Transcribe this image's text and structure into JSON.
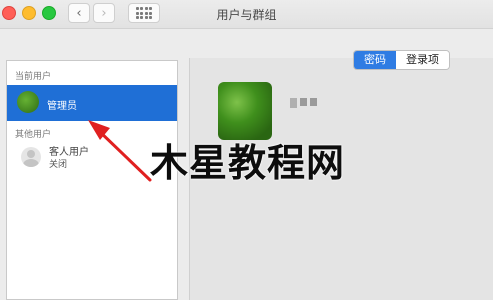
{
  "window": {
    "title": "用户与群组"
  },
  "toolbar": {
    "back_icon": "chevron-left-icon",
    "forward_icon": "chevron-right-icon",
    "grid_icon": "show-all-grid-icon",
    "back_glyph": "‹",
    "forward_glyph": "›"
  },
  "sidebar": {
    "current_users_header": "当前用户",
    "admin_label": "管理员",
    "other_users_header": "其他用户",
    "guest_name": "客人用户",
    "guest_status": "关闭"
  },
  "tabs": {
    "password": "密码",
    "login_items": "登录项",
    "active": "password"
  },
  "watermark": {
    "text": "木星教程网"
  },
  "colors": {
    "selection_blue": "#1f6fd6",
    "segment_active": "#2f7ce3",
    "arrow_red": "#e02020"
  }
}
